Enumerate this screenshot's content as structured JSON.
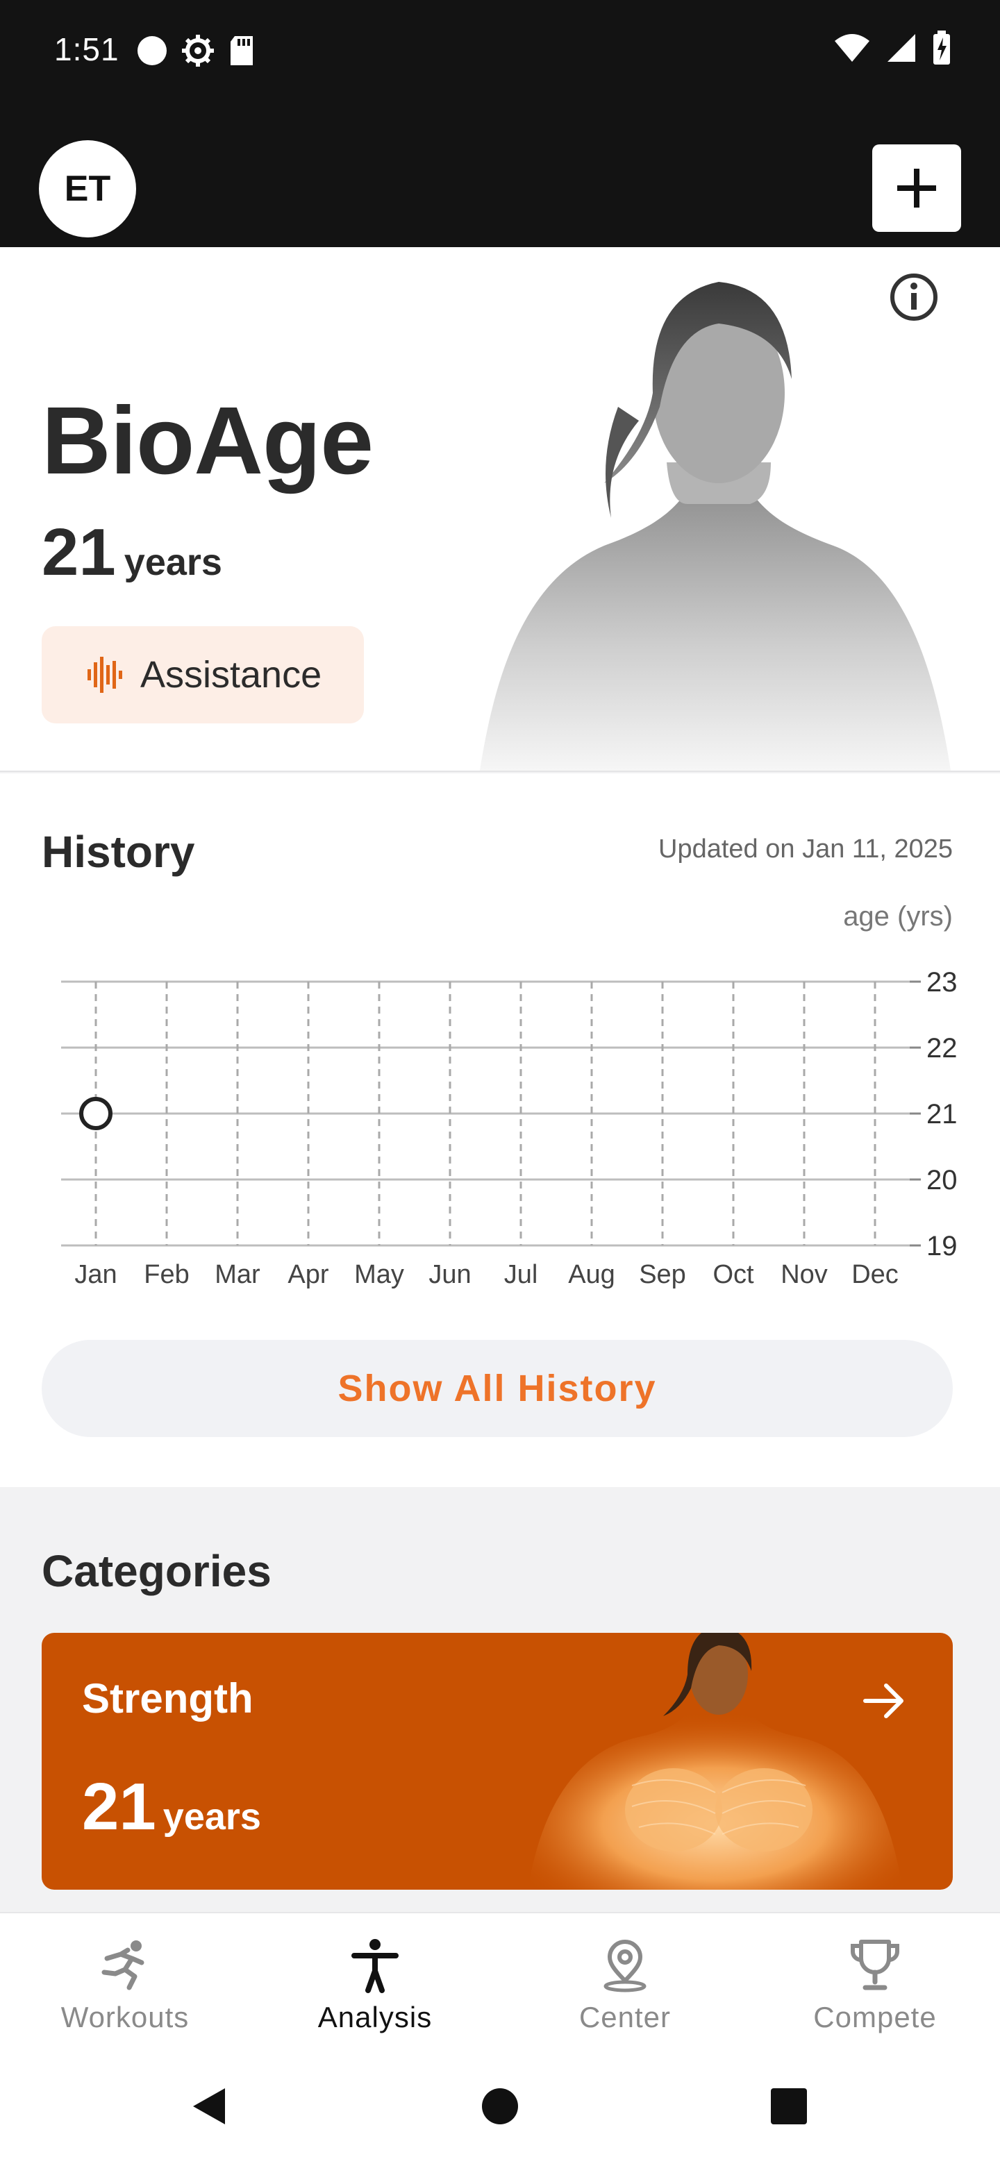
{
  "status": {
    "time": "1:51",
    "icons_left": [
      "circle-icon",
      "settings-icon",
      "sd-card-icon"
    ],
    "icons_right": [
      "wifi-icon",
      "signal-icon",
      "battery-charging-icon"
    ]
  },
  "header": {
    "avatar_initials": "ET",
    "add_icon": "plus-icon"
  },
  "hero": {
    "title": "BioAge",
    "age_value": "21",
    "age_unit": "years",
    "assist_label": "Assistance",
    "info_icon": "info-icon"
  },
  "history": {
    "title": "History",
    "updated": "Updated on Jan 11, 2025",
    "show_all_label": "Show All History"
  },
  "chart_data": {
    "type": "scatter",
    "ylabel": "age (yrs)",
    "categories": [
      "Jan",
      "Feb",
      "Mar",
      "Apr",
      "May",
      "Jun",
      "Jul",
      "Aug",
      "Sep",
      "Oct",
      "Nov",
      "Dec"
    ],
    "yticks": [
      "23",
      "22",
      "21",
      "20",
      "19"
    ],
    "ylim": [
      19,
      23
    ],
    "points": [
      {
        "x": "Jan",
        "y": 21
      }
    ],
    "grid": true,
    "accent": "#222222"
  },
  "categories": {
    "title": "Categories",
    "cards": [
      {
        "name": "Strength",
        "age_value": "21",
        "age_unit": "years",
        "color": "#c85102"
      }
    ]
  },
  "nav": {
    "items": [
      {
        "label": "Workouts",
        "icon": "running-person-icon",
        "active": false
      },
      {
        "label": "Analysis",
        "icon": "body-figure-icon",
        "active": true
      },
      {
        "label": "Center",
        "icon": "location-pin-icon",
        "active": false
      },
      {
        "label": "Compete",
        "icon": "trophy-icon",
        "active": false
      }
    ]
  },
  "colors": {
    "accent": "#ee7329",
    "card": "#c85102",
    "assist_bg": "#fdeee6"
  }
}
